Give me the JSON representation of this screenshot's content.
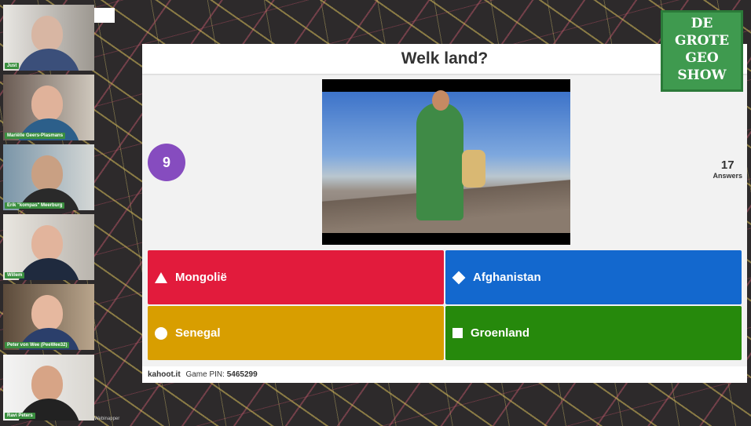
{
  "participants": [
    {
      "name": "Just"
    },
    {
      "name": "Mariëlle Geers-Plasmans"
    },
    {
      "name": "Erik \"kompas\" Meerburg"
    },
    {
      "name": "Willem"
    },
    {
      "name": "Peter von Wee (PeeWee32)"
    },
    {
      "name": "Ravi Peters"
    }
  ],
  "webinapper_label": "Webinapper",
  "quiz": {
    "question": "Welk land?",
    "timer": "9",
    "answers_count": "17",
    "answers_label": "Answers",
    "options": [
      {
        "label": "Mongolië",
        "shape": "triangle-icon",
        "color": "#e21b3c"
      },
      {
        "label": "Afghanistan",
        "shape": "diamond-icon",
        "color": "#1368ce"
      },
      {
        "label": "Senegal",
        "shape": "circle-icon",
        "color": "#d89e00"
      },
      {
        "label": "Groenland",
        "shape": "square-icon",
        "color": "#26890c"
      }
    ],
    "footer": {
      "site": "kahoot.it",
      "pin_label": "Game PIN:",
      "pin": "5465299"
    }
  },
  "logo": {
    "line1": "DE",
    "line2": "GROTE",
    "line3": "GEO",
    "line4": "SHOW"
  }
}
